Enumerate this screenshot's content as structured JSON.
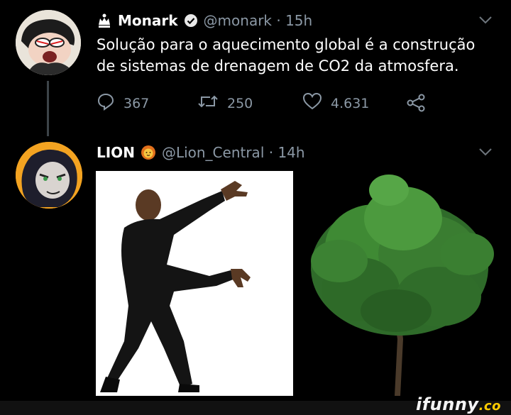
{
  "tweet1": {
    "name": "Monark",
    "handle_time": "@monark · 15h",
    "text_line1": "Solução para o aquecimento global é a construção",
    "text_line2": "de sistemas de drenagem de CO2 da atmosfera.",
    "replies": "367",
    "retweets": "250",
    "likes": "4.631"
  },
  "tweet2": {
    "name": "LION",
    "emoji": "lion-emoji",
    "handle_time": "@Lion_Central · 14h"
  },
  "watermark": {
    "text": "ifunny",
    "suffix": ".co"
  },
  "colors": {
    "background": "#000000",
    "secondary_text": "#8b98a5",
    "thread_line": "#3d4449",
    "verified_badge": "#e8e8e8"
  },
  "icons": [
    "crown-icon",
    "verified-icon",
    "reply-icon",
    "retweet-icon",
    "like-icon",
    "share-icon",
    "chevron-down-icon"
  ]
}
